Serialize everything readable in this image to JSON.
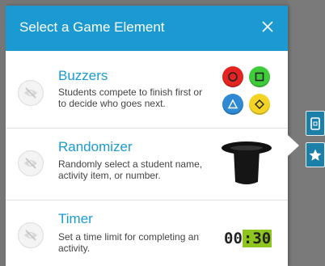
{
  "dialog": {
    "title": "Select a Game Element",
    "close_symbol": "×"
  },
  "items": [
    {
      "title": "Buzzers",
      "description": "Students compete to finish first or to decide who goes next.",
      "visibility_icon": "hidden-eye-icon",
      "image": "buzzer-buttons-icon"
    },
    {
      "title": "Randomizer",
      "description": "Randomly select a student name, activity item, or number.",
      "visibility_icon": "hidden-eye-icon",
      "image": "magic-hat-icon"
    },
    {
      "title": "Timer",
      "description": "Set a time limit for completing an activity.",
      "visibility_icon": "hidden-eye-icon",
      "timer_minutes": "00",
      "timer_seconds": ":30"
    }
  ],
  "colors": {
    "accent": "#1b9ad1",
    "overlay": "#767676",
    "timer_highlight": "#8ec51f"
  }
}
